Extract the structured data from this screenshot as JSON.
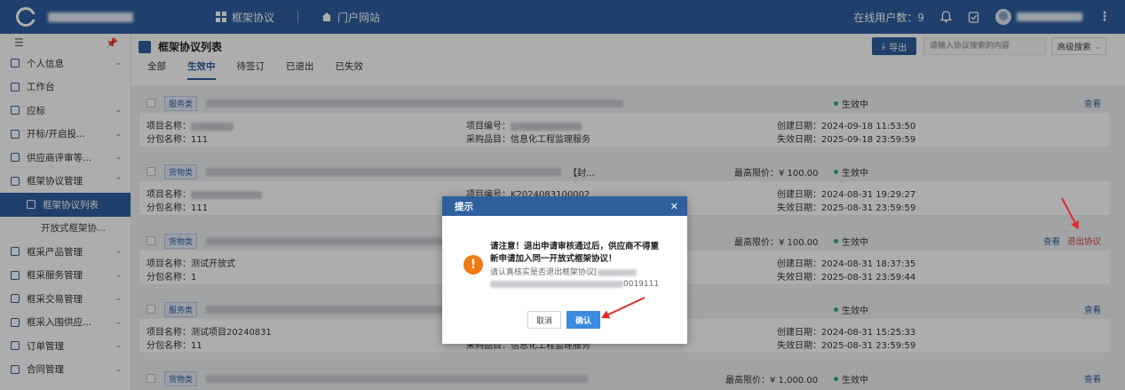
{
  "topbar": {
    "nav": [
      {
        "label": "框架协议",
        "icon": "grid-icon"
      },
      {
        "label": "门户网站",
        "icon": "home-icon"
      }
    ],
    "online_users": "在线用户数：9",
    "icons": [
      "bell-icon",
      "clipboard-icon",
      "more-vertical-icon"
    ]
  },
  "sidebar": {
    "items": [
      {
        "label": "个人信息",
        "chevron": "⌄"
      },
      {
        "label": "工作台",
        "chevron": ""
      },
      {
        "label": "应标",
        "chevron": "⌄"
      },
      {
        "label": "开标/开启投...",
        "chevron": "⌄"
      },
      {
        "label": "供应商评审等...",
        "chevron": "⌄"
      },
      {
        "label": "框架协议管理",
        "chevron": "⌃"
      },
      {
        "label": "框架协议列表",
        "chevron": ""
      },
      {
        "label": "开放式框架协...",
        "chevron": ""
      },
      {
        "label": "框采产品管理",
        "chevron": "⌄"
      },
      {
        "label": "框采服务管理",
        "chevron": "⌄"
      },
      {
        "label": "框采交易管理",
        "chevron": "⌄"
      },
      {
        "label": "框采入围供应...",
        "chevron": "⌄"
      },
      {
        "label": "订单管理",
        "chevron": "⌄"
      },
      {
        "label": "合同管理",
        "chevron": "⌄"
      }
    ]
  },
  "page": {
    "title": "框架协议列表",
    "tabs": [
      "全部",
      "生效中",
      "待签订",
      "已退出",
      "已失效"
    ],
    "active_tab": "生效中",
    "export_label": "导出",
    "search_placeholder": "请输入协议搜索的内容",
    "advanced_search": "高级搜索"
  },
  "labels": {
    "project_name": "项目名称：",
    "package_name": "分包名称：",
    "project_no": "项目编号：",
    "purchase_item": "采购品目：",
    "created": "创建日期：",
    "expires": "失效日期：",
    "max_price_prefix": "最高限价：",
    "status": "生效中",
    "view": "查看",
    "exit": "退出协议"
  },
  "cards": [
    {
      "tag": "服务类",
      "title_suffix": "",
      "max_price": "",
      "project_name": "",
      "package_name": "111",
      "project_no": "",
      "purchase_item": "信息化工程监理服务",
      "created": "2024-09-18 11:53:50",
      "expires": "2025-09-18 23:59:59",
      "exit": false
    },
    {
      "tag": "货物类",
      "title_suffix": "【封...",
      "max_price": "¥ 100.00",
      "project_name": "",
      "package_name": "111",
      "project_no": "K2024083100002",
      "purchase_item": "",
      "created": "2024-08-31 19:29:27",
      "expires": "2025-08-31 23:59:59",
      "exit": false
    },
    {
      "tag": "货物类",
      "title_suffix": "",
      "max_price": "¥ 100.00",
      "project_name": "测试开放式",
      "package_name": "1",
      "project_no": "",
      "purchase_item": "",
      "created": "2024-08-31 18:37:35",
      "expires": "2025-08-31 23:59:44",
      "exit": true
    },
    {
      "tag": "服务类",
      "title_suffix": "",
      "max_price": "",
      "project_name": "测试项目20240831",
      "package_name": "11",
      "project_no": "",
      "purchase_item": "信息化工程监理服务",
      "created": "2024-08-31 15:25:33",
      "expires": "2025-08-31 23:59:59",
      "exit": false
    },
    {
      "tag": "货物类",
      "title_suffix": "",
      "max_price": "¥ 1,000.00",
      "project_name": "",
      "package_name": "",
      "project_no": "",
      "purchase_item": "",
      "created": "",
      "expires": "",
      "exit": false
    }
  ],
  "modal": {
    "title": "提示",
    "warning_line1": "请注意！退出申请审核通过后，供应商不得重",
    "warning_line2": "新申请加入同一开放式框架协议！",
    "confirm_text_prefix": "请认真核实是否退出框架协议[",
    "confirm_text_suffix": "0019111",
    "cancel_label": "取消",
    "ok_label": "确认"
  },
  "colors": {
    "primary": "#2f5f9f",
    "status_green": "#2fb36e",
    "warning_orange": "#f07a12",
    "annotation_red": "#e02a2a"
  }
}
